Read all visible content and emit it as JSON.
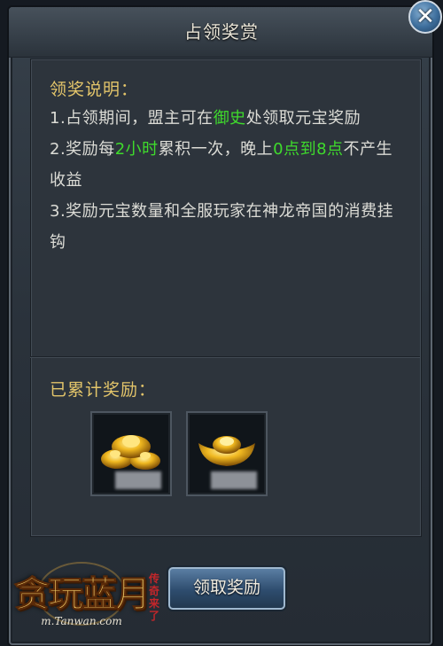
{
  "dialog": {
    "title": "占领奖赏",
    "close_glyph": "✕"
  },
  "instructions": {
    "heading": "领奖说明：",
    "lines": [
      {
        "parts": [
          "1.占领期间，盟主可在",
          "御史",
          "处领取元宝奖励"
        ]
      },
      {
        "parts": [
          "2.奖励每",
          "2小时",
          "累积一次，晚上",
          "0点到8点",
          "不产生收益"
        ]
      },
      {
        "parts": [
          "3.奖励元宝数量和全服玩家在神龙帝国的消费挂钩"
        ]
      }
    ]
  },
  "rewards": {
    "heading": "已累计奖励：",
    "items": [
      {
        "icon": "gold-ingot-pile-icon"
      },
      {
        "icon": "gold-ingot-icon"
      }
    ]
  },
  "claim_button": {
    "label": "领取奖励"
  },
  "logo": {
    "text": "贪玩蓝月",
    "sub": "传奇来了",
    "url": "m.Tanwan.com"
  },
  "colors": {
    "highlight": "#3fdb2c",
    "heading": "#e3c56a",
    "text": "#dcdcd6"
  }
}
